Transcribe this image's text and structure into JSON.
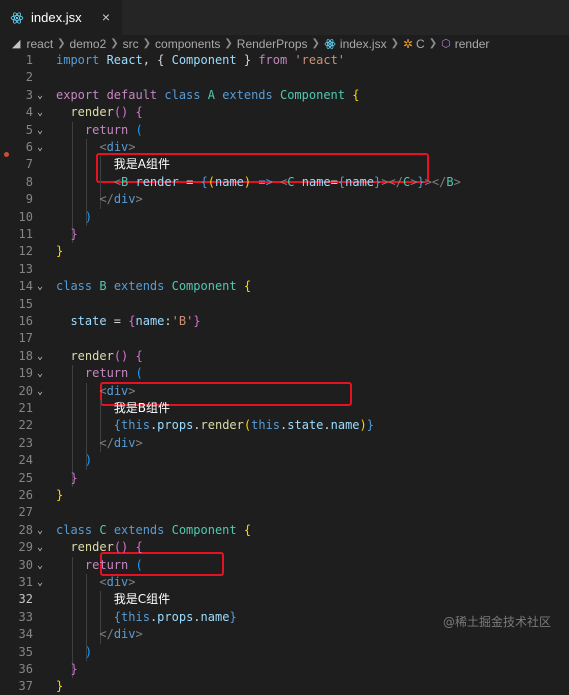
{
  "tab": {
    "filename": "index.jsx",
    "close": "×"
  },
  "breadcrumb": [
    "react",
    "demo2",
    "src",
    "components",
    "RenderProps",
    "index.jsx",
    "C",
    "render"
  ],
  "lines": [
    {
      "n": "1",
      "code": [
        [
          "k",
          "import "
        ],
        [
          "v",
          "React"
        ],
        [
          "p",
          ", { "
        ],
        [
          "v",
          "Component"
        ],
        [
          "p",
          " } "
        ],
        [
          "kc",
          "from "
        ],
        [
          "s",
          "'react'"
        ]
      ]
    },
    {
      "n": "2",
      "code": []
    },
    {
      "n": "3",
      "fold": "⌄",
      "code": [
        [
          "kc",
          "export "
        ],
        [
          "kc",
          "default "
        ],
        [
          "k",
          "class "
        ],
        [
          "cls",
          "A "
        ],
        [
          "k",
          "extends "
        ],
        [
          "cls",
          "Component "
        ],
        [
          "br1",
          "{"
        ]
      ]
    },
    {
      "n": "4",
      "fold": "⌄",
      "code": [
        [
          "p",
          "  "
        ],
        [
          "fn",
          "render"
        ],
        [
          "br2",
          "()"
        ],
        [
          "p",
          " "
        ],
        [
          "br2",
          "{"
        ]
      ]
    },
    {
      "n": "5",
      "fold": "⌄",
      "code": [
        [
          "p",
          "    "
        ],
        [
          "kc",
          "return "
        ],
        [
          "br3",
          "("
        ]
      ]
    },
    {
      "n": "6",
      "fold": "⌄",
      "code": [
        [
          "p",
          "      "
        ],
        [
          "t",
          "<"
        ],
        [
          "tn",
          "div"
        ],
        [
          "t",
          ">"
        ]
      ]
    },
    {
      "n": "7",
      "code": [
        [
          "p",
          "        "
        ],
        [
          "txt",
          "我是A组件"
        ]
      ]
    },
    {
      "n": "8",
      "code": [
        [
          "p",
          "        "
        ],
        [
          "t",
          "<"
        ],
        [
          "cn",
          "B "
        ],
        [
          "v",
          "render"
        ],
        [
          "p",
          " = "
        ],
        [
          "k",
          "{"
        ],
        [
          "br1",
          "("
        ],
        [
          "v",
          "name"
        ],
        [
          "br1",
          ")"
        ],
        [
          "p",
          " "
        ],
        [
          "k",
          "=>"
        ],
        [
          "p",
          " "
        ],
        [
          "t",
          "<"
        ],
        [
          "cn",
          "C "
        ],
        [
          "v",
          "name"
        ],
        [
          "p",
          "="
        ],
        [
          "k",
          "{"
        ],
        [
          "v",
          "name"
        ],
        [
          "k",
          "}"
        ],
        [
          "t",
          "></"
        ],
        [
          "cn",
          "C"
        ],
        [
          "t",
          ">"
        ],
        [
          "k",
          "}"
        ],
        [
          "t",
          "></"
        ],
        [
          "cn",
          "B"
        ],
        [
          "t",
          ">"
        ]
      ]
    },
    {
      "n": "9",
      "code": [
        [
          "p",
          "      "
        ],
        [
          "t",
          "</"
        ],
        [
          "tn",
          "div"
        ],
        [
          "t",
          ">"
        ]
      ]
    },
    {
      "n": "10",
      "code": [
        [
          "p",
          "    "
        ],
        [
          "br3",
          ")"
        ]
      ]
    },
    {
      "n": "11",
      "code": [
        [
          "p",
          "  "
        ],
        [
          "br2",
          "}"
        ]
      ]
    },
    {
      "n": "12",
      "code": [
        [
          "br1",
          "}"
        ]
      ]
    },
    {
      "n": "13",
      "code": []
    },
    {
      "n": "14",
      "fold": "⌄",
      "code": [
        [
          "k",
          "class "
        ],
        [
          "cls",
          "B "
        ],
        [
          "k",
          "extends "
        ],
        [
          "cls",
          "Component "
        ],
        [
          "br1",
          "{"
        ]
      ]
    },
    {
      "n": "15",
      "code": []
    },
    {
      "n": "16",
      "code": [
        [
          "p",
          "  "
        ],
        [
          "v",
          "state"
        ],
        [
          "p",
          " = "
        ],
        [
          "br2",
          "{"
        ],
        [
          "v",
          "name"
        ],
        [
          "p",
          ":"
        ],
        [
          "s",
          "'B'"
        ],
        [
          "br2",
          "}"
        ]
      ]
    },
    {
      "n": "17",
      "code": []
    },
    {
      "n": "18",
      "fold": "⌄",
      "code": [
        [
          "p",
          "  "
        ],
        [
          "fn",
          "render"
        ],
        [
          "br2",
          "()"
        ],
        [
          "p",
          " "
        ],
        [
          "br2",
          "{"
        ]
      ]
    },
    {
      "n": "19",
      "fold": "⌄",
      "code": [
        [
          "p",
          "    "
        ],
        [
          "kc",
          "return "
        ],
        [
          "br3",
          "("
        ]
      ]
    },
    {
      "n": "20",
      "fold": "⌄",
      "code": [
        [
          "p",
          "      "
        ],
        [
          "t",
          "<"
        ],
        [
          "tn",
          "div"
        ],
        [
          "t",
          ">"
        ]
      ]
    },
    {
      "n": "21",
      "code": [
        [
          "p",
          "        "
        ],
        [
          "txt",
          "我是B组件"
        ]
      ]
    },
    {
      "n": "22",
      "code": [
        [
          "p",
          "        "
        ],
        [
          "k",
          "{"
        ],
        [
          "k",
          "this"
        ],
        [
          "p",
          "."
        ],
        [
          "v",
          "props"
        ],
        [
          "p",
          "."
        ],
        [
          "fn",
          "render"
        ],
        [
          "br1",
          "("
        ],
        [
          "k",
          "this"
        ],
        [
          "p",
          "."
        ],
        [
          "v",
          "state"
        ],
        [
          "p",
          "."
        ],
        [
          "v",
          "name"
        ],
        [
          "br1",
          ")"
        ],
        [
          "k",
          "}"
        ]
      ]
    },
    {
      "n": "23",
      "code": [
        [
          "p",
          "      "
        ],
        [
          "t",
          "</"
        ],
        [
          "tn",
          "div"
        ],
        [
          "t",
          ">"
        ]
      ]
    },
    {
      "n": "24",
      "code": [
        [
          "p",
          "    "
        ],
        [
          "br3",
          ")"
        ]
      ]
    },
    {
      "n": "25",
      "code": [
        [
          "p",
          "  "
        ],
        [
          "br2",
          "}"
        ]
      ]
    },
    {
      "n": "26",
      "code": [
        [
          "br1",
          "}"
        ]
      ]
    },
    {
      "n": "27",
      "code": []
    },
    {
      "n": "28",
      "fold": "⌄",
      "code": [
        [
          "k",
          "class "
        ],
        [
          "cls",
          "C "
        ],
        [
          "k",
          "extends "
        ],
        [
          "cls",
          "Component "
        ],
        [
          "br1",
          "{"
        ]
      ]
    },
    {
      "n": "29",
      "fold": "⌄",
      "code": [
        [
          "p",
          "  "
        ],
        [
          "fn",
          "render"
        ],
        [
          "br2",
          "()"
        ],
        [
          "p",
          " "
        ],
        [
          "br2",
          "{"
        ]
      ]
    },
    {
      "n": "30",
      "fold": "⌄",
      "code": [
        [
          "p",
          "    "
        ],
        [
          "kc",
          "return "
        ],
        [
          "br3",
          "("
        ]
      ]
    },
    {
      "n": "31",
      "fold": "⌄",
      "code": [
        [
          "p",
          "      "
        ],
        [
          "t",
          "<"
        ],
        [
          "tn",
          "div"
        ],
        [
          "t",
          ">"
        ]
      ]
    },
    {
      "n": "32",
      "code": [
        [
          "p",
          "        "
        ],
        [
          "txt",
          "我是C组件"
        ]
      ]
    },
    {
      "n": "33",
      "code": [
        [
          "p",
          "        "
        ],
        [
          "k",
          "{"
        ],
        [
          "k",
          "this"
        ],
        [
          "p",
          "."
        ],
        [
          "v",
          "props"
        ],
        [
          "p",
          "."
        ],
        [
          "v",
          "name"
        ],
        [
          "k",
          "}"
        ]
      ]
    },
    {
      "n": "34",
      "code": [
        [
          "p",
          "      "
        ],
        [
          "t",
          "</"
        ],
        [
          "tn",
          "div"
        ],
        [
          "t",
          ">"
        ]
      ]
    },
    {
      "n": "35",
      "code": [
        [
          "p",
          "    "
        ],
        [
          "br3",
          ")"
        ]
      ]
    },
    {
      "n": "36",
      "code": [
        [
          "p",
          "  "
        ],
        [
          "br2",
          "}"
        ]
      ]
    },
    {
      "n": "37",
      "code": [
        [
          "br1",
          "}"
        ]
      ]
    }
  ],
  "watermark": "@稀土掘金技术社区"
}
